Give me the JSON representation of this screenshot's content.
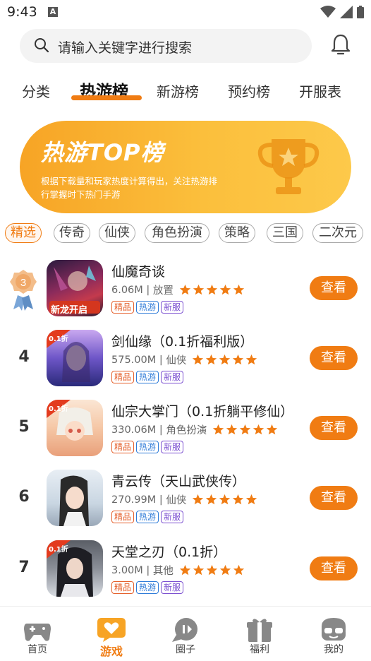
{
  "status": {
    "time": "9:43",
    "notif": "A"
  },
  "search": {
    "placeholder": "请输入关键字进行搜索"
  },
  "tabs": [
    {
      "label": "分类"
    },
    {
      "label": "热游榜"
    },
    {
      "label": "新游榜"
    },
    {
      "label": "预约榜"
    },
    {
      "label": "开服表"
    }
  ],
  "banner": {
    "title": "热游TOP榜",
    "desc": "根据下载量和玩家热度计算得出，关注热游排行掌握时下热门手游"
  },
  "chips": [
    "精选",
    "传奇",
    "仙侠",
    "角色扮演",
    "策略",
    "三国",
    "二次元"
  ],
  "games": [
    {
      "rank": "3",
      "name": "仙魔奇谈",
      "size": "6.06M",
      "category": "放置",
      "stars": 5,
      "tags": [
        "精品",
        "热游",
        "新服"
      ],
      "badge": "新龙开启",
      "button": "查看"
    },
    {
      "rank": "4",
      "name": "剑仙缘（0.1折福利版）",
      "size": "575.00M",
      "category": "仙侠",
      "stars": 5,
      "tags": [
        "精品",
        "热游",
        "新服"
      ],
      "badge": "0.1折",
      "button": "查看"
    },
    {
      "rank": "5",
      "name": "仙宗大掌门（0.1折躺平修仙）",
      "size": "330.06M",
      "category": "角色扮演",
      "stars": 5,
      "tags": [
        "精品",
        "热游",
        "新服"
      ],
      "badge": "0.1折",
      "button": "查看"
    },
    {
      "rank": "6",
      "name": "青云传（天山武侠传）",
      "size": "270.99M",
      "category": "仙侠",
      "stars": 5,
      "tags": [
        "精品",
        "热游",
        "新服"
      ],
      "badge": "",
      "button": "查看"
    },
    {
      "rank": "7",
      "name": "天堂之刃（0.1折）",
      "size": "3.00M",
      "category": "其他",
      "stars": 5,
      "tags": [
        "精品",
        "热游",
        "新服"
      ],
      "badge": "0.1折",
      "button": "查看"
    }
  ],
  "nav": [
    {
      "label": "首页",
      "icon": "gamepad-icon"
    },
    {
      "label": "游戏",
      "icon": "heart-chat-icon"
    },
    {
      "label": "圈子",
      "icon": "circle-chat-icon"
    },
    {
      "label": "福利",
      "icon": "gift-icon"
    },
    {
      "label": "我的",
      "icon": "face-icon"
    }
  ],
  "colors": {
    "accent": "#f07c13",
    "tag_jp": "#e5602c",
    "tag_ry": "#2e7bd8",
    "tag_xf": "#7b4fd0"
  }
}
